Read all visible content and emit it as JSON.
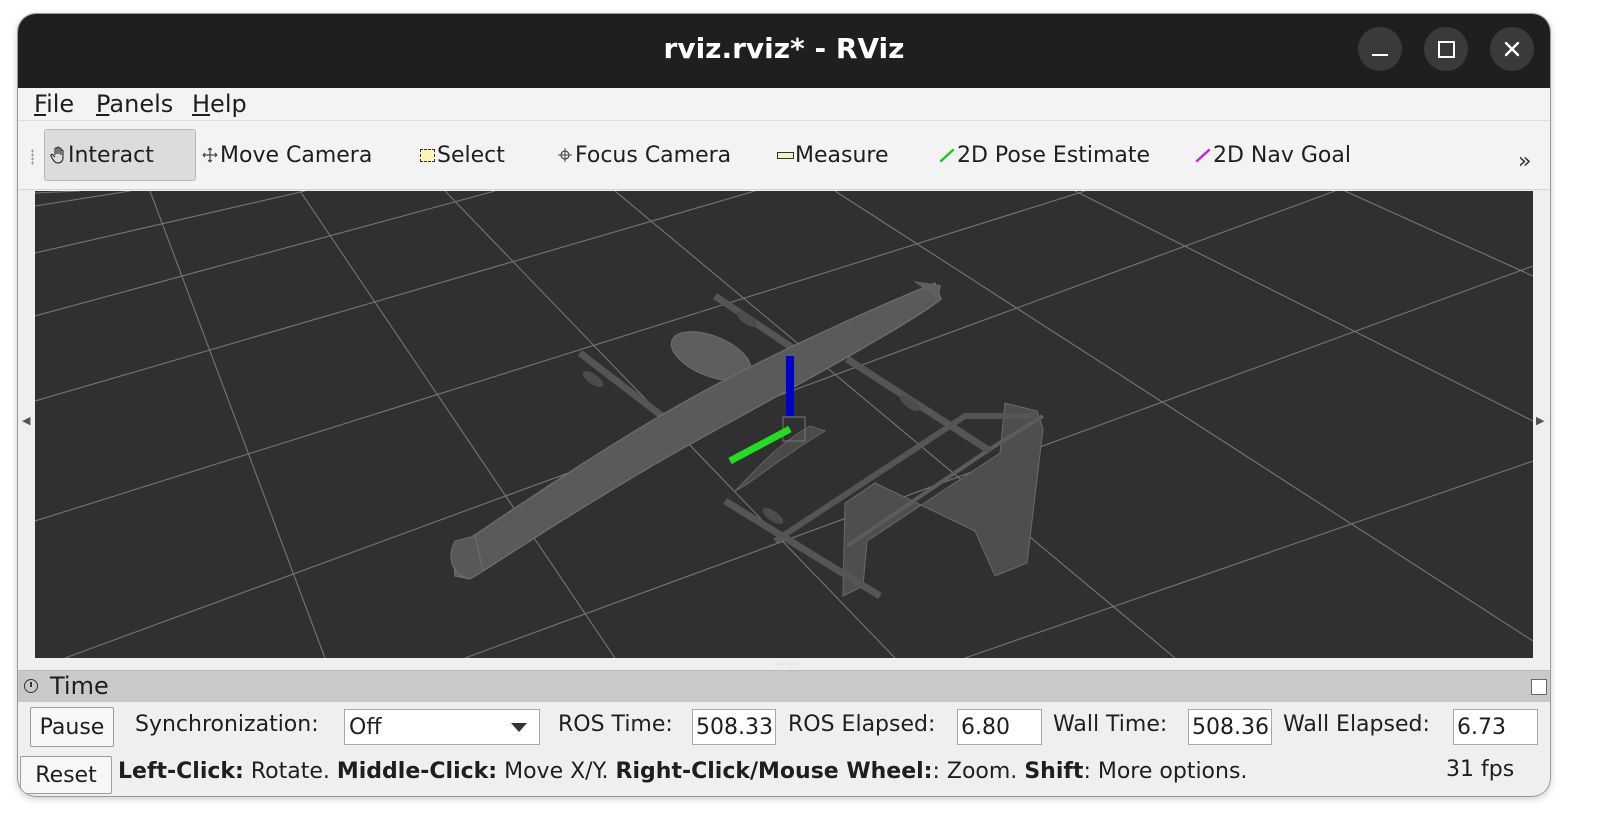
{
  "window": {
    "title": "rviz.rviz* - RViz"
  },
  "menubar": {
    "items": [
      "File",
      "Panels",
      "Help"
    ]
  },
  "toolbar": {
    "tools": [
      {
        "label": "Interact",
        "icon": "hand-icon",
        "active": true
      },
      {
        "label": "Move Camera",
        "icon": "move-camera-icon",
        "active": false
      },
      {
        "label": "Select",
        "icon": "select-icon",
        "active": false
      },
      {
        "label": "Focus Camera",
        "icon": "focus-camera-icon",
        "active": false
      },
      {
        "label": "Measure",
        "icon": "measure-icon",
        "active": false
      },
      {
        "label": "2D Pose Estimate",
        "icon": "pose-estimate-icon",
        "active": false
      },
      {
        "label": "2D Nav Goal",
        "icon": "nav-goal-icon",
        "active": false
      }
    ],
    "overflow": "»"
  },
  "time_panel": {
    "title": "Time",
    "pause_label": "Pause",
    "sync_label": "Synchronization:",
    "sync_value": "Off",
    "ros_time_label": "ROS Time:",
    "ros_time_value": "508.33",
    "ros_elapsed_label": "ROS Elapsed:",
    "ros_elapsed_value": "6.80",
    "wall_time_label": "Wall Time:",
    "wall_time_value": "508.36",
    "wall_elapsed_label": "Wall Elapsed:",
    "wall_elapsed_value": "6.73"
  },
  "status": {
    "reset_label": "Reset",
    "left_click": "Left-Click:",
    "left_action": " Rotate. ",
    "middle_click": "Middle-Click:",
    "middle_action": " Move X/Y. ",
    "right_click": "Right-Click/Mouse Wheel:",
    "right_action": ": Zoom. ",
    "shift": "Shift",
    "shift_action": ": More options.",
    "fps": "31 fps"
  },
  "colors": {
    "titlebar": "#1f1f1f",
    "viewport_bg": "#303030",
    "grid": "#8a8a8a",
    "model": "#5a5a5a",
    "axis_x_green": "#22dd22",
    "axis_z_blue": "#0000cc"
  }
}
